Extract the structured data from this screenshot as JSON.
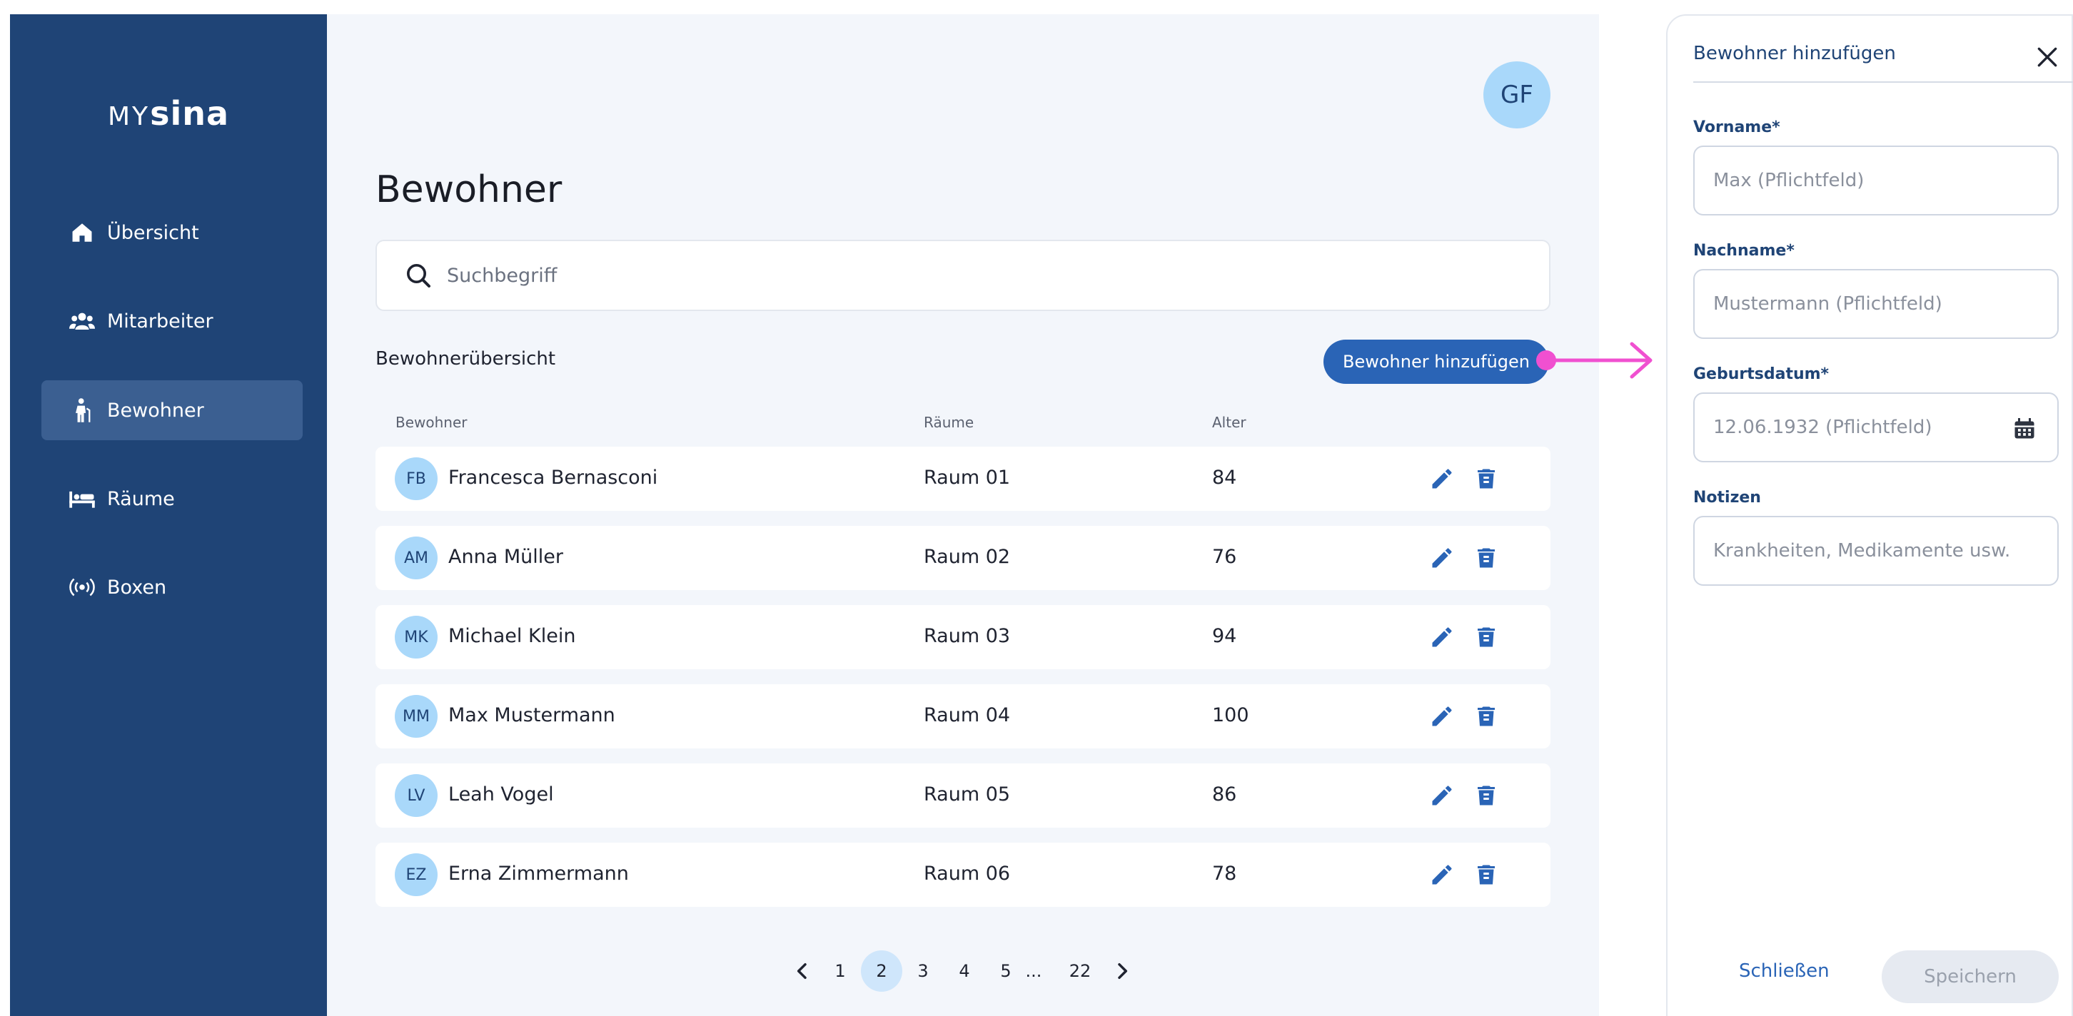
{
  "brand": {
    "prefix": "MY",
    "name": "sina"
  },
  "sidebar": {
    "items": [
      {
        "label": "Übersicht",
        "icon": "home-icon"
      },
      {
        "label": "Mitarbeiter",
        "icon": "group-icon"
      },
      {
        "label": "Bewohner",
        "icon": "elderly-person-icon",
        "active": true
      },
      {
        "label": "Räume",
        "icon": "bed-icon"
      },
      {
        "label": "Boxen",
        "icon": "broadcast-icon"
      }
    ]
  },
  "header": {
    "avatar_initials": "GF"
  },
  "main": {
    "title": "Bewohner",
    "search_placeholder": "Suchbegriff",
    "section_title": "Bewohnerübersicht",
    "add_button": "Bewohner hinzufügen",
    "columns": {
      "resident": "Bewohner",
      "rooms": "Räume",
      "age": "Alter"
    },
    "rows": [
      {
        "initials": "FB",
        "name": "Francesca Bernasconi",
        "room": "Raum 01",
        "age": "84"
      },
      {
        "initials": "AM",
        "name": "Anna Müller",
        "room": "Raum 02",
        "age": "76"
      },
      {
        "initials": "MK",
        "name": "Michael Klein",
        "room": "Raum 03",
        "age": "94"
      },
      {
        "initials": "MM",
        "name": "Max Mustermann",
        "room": "Raum 04",
        "age": "100"
      },
      {
        "initials": "LV",
        "name": "Leah Vogel",
        "room": "Raum 05",
        "age": "86"
      },
      {
        "initials": "EZ",
        "name": "Erna Zimmermann",
        "room": "Raum 06",
        "age": "78"
      }
    ],
    "pagination": {
      "pages": [
        "1",
        "2",
        "3",
        "4",
        "5",
        "...",
        "22"
      ],
      "current": "2"
    }
  },
  "drawer": {
    "title": "Bewohner hinzufügen",
    "fields": {
      "first_name": {
        "label": "Vorname*",
        "placeholder": "Max (Pflichtfeld)"
      },
      "last_name": {
        "label": "Nachname*",
        "placeholder": "Mustermann (Pflichtfeld)"
      },
      "birthdate": {
        "label": "Geburtsdatum*",
        "placeholder": "12.06.1932 (Pflichtfeld)"
      },
      "notes": {
        "label": "Notizen",
        "placeholder": "Krankheiten, Medikamente usw."
      }
    },
    "close_label": "Schließen",
    "save_label": "Speichern"
  },
  "colors": {
    "sidebar": "#1f4476",
    "sidebar_active": "#3b5f91",
    "primary": "#2a64b6",
    "avatar": "#a9d8fa",
    "background": "#f3f6fb",
    "annotation": "#f050d0"
  }
}
